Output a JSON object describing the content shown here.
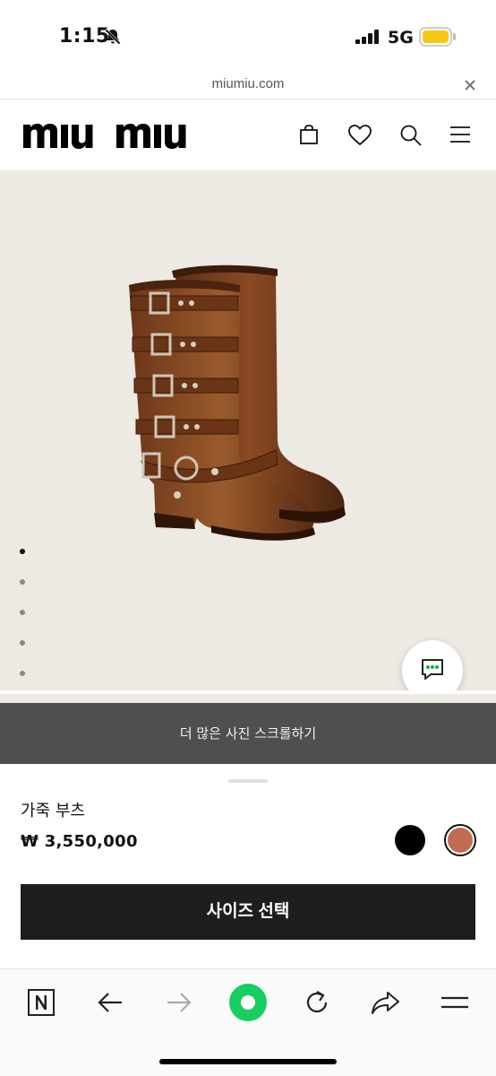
{
  "status_bar": {
    "time": "1:15",
    "network": "5G",
    "battery_color": "#f5c816"
  },
  "url_bar": {
    "domain": "miumiu.com"
  },
  "header": {
    "logo_text": "miu miu",
    "icons": [
      "bag-icon",
      "heart-icon",
      "search-icon",
      "menu-icon"
    ]
  },
  "gallery": {
    "image_count": 5,
    "active_index": 0,
    "background": "#ede9e3"
  },
  "scroll_banner": {
    "text": "더 많은 사진 스크롤하기"
  },
  "product": {
    "name": "가죽 부츠",
    "price": "₩ 3,550,000",
    "colors": [
      "#000000",
      "#c06c52"
    ],
    "selected_color": "#c06c52",
    "size_button_label": "사이즈 선택"
  },
  "browser_toolbar": {
    "items": [
      "naver-icon",
      "back-icon",
      "forward-icon",
      "green-dot-icon",
      "reload-icon",
      "share-icon",
      "menu-icon"
    ],
    "accent": "#19ce60"
  }
}
